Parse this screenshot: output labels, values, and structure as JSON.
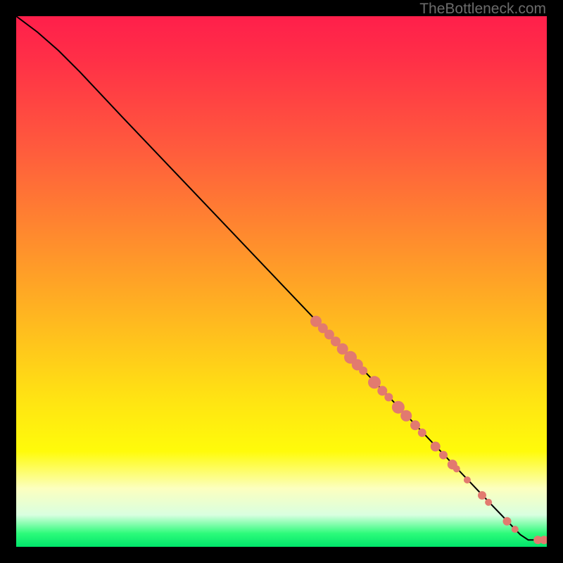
{
  "attribution": "TheBottleneck.com",
  "chart_data": {
    "type": "line",
    "title": "",
    "xlabel": "",
    "ylabel": "",
    "xlim": [
      0,
      100
    ],
    "ylim": [
      0,
      100
    ],
    "curve": {
      "name": "bottleneck-curve",
      "points": [
        {
          "x": 0,
          "y": 100
        },
        {
          "x": 4,
          "y": 97
        },
        {
          "x": 8,
          "y": 93.5
        },
        {
          "x": 12,
          "y": 89.5
        },
        {
          "x": 20,
          "y": 81
        },
        {
          "x": 30,
          "y": 70.5
        },
        {
          "x": 40,
          "y": 60
        },
        {
          "x": 50,
          "y": 49.5
        },
        {
          "x": 60,
          "y": 39
        },
        {
          "x": 70,
          "y": 28.5
        },
        {
          "x": 80,
          "y": 18
        },
        {
          "x": 90,
          "y": 7.5
        },
        {
          "x": 95,
          "y": 2.3
        },
        {
          "x": 96.5,
          "y": 1.3
        },
        {
          "x": 100,
          "y": 1.3
        }
      ]
    },
    "markers": {
      "name": "highlighted-points",
      "color": "#e27a6f",
      "points": [
        {
          "x": 56.5,
          "y": 42.5,
          "r": 8
        },
        {
          "x": 57.8,
          "y": 41.2,
          "r": 7
        },
        {
          "x": 59.0,
          "y": 40.0,
          "r": 7
        },
        {
          "x": 60.2,
          "y": 38.7,
          "r": 7
        },
        {
          "x": 61.5,
          "y": 37.3,
          "r": 8
        },
        {
          "x": 63.0,
          "y": 35.7,
          "r": 9
        },
        {
          "x": 64.3,
          "y": 34.3,
          "r": 8
        },
        {
          "x": 65.4,
          "y": 33.2,
          "r": 6
        },
        {
          "x": 67.5,
          "y": 31.0,
          "r": 9
        },
        {
          "x": 69.0,
          "y": 29.4,
          "r": 7
        },
        {
          "x": 70.2,
          "y": 28.2,
          "r": 6
        },
        {
          "x": 72.0,
          "y": 26.3,
          "r": 9
        },
        {
          "x": 73.5,
          "y": 24.7,
          "r": 8
        },
        {
          "x": 75.2,
          "y": 22.9,
          "r": 7
        },
        {
          "x": 76.5,
          "y": 21.5,
          "r": 6
        },
        {
          "x": 79.0,
          "y": 18.9,
          "r": 7
        },
        {
          "x": 80.5,
          "y": 17.3,
          "r": 6
        },
        {
          "x": 82.2,
          "y": 15.5,
          "r": 7
        },
        {
          "x": 83.0,
          "y": 14.7,
          "r": 5
        },
        {
          "x": 85.0,
          "y": 12.6,
          "r": 5
        },
        {
          "x": 87.8,
          "y": 9.7,
          "r": 6
        },
        {
          "x": 89.0,
          "y": 8.4,
          "r": 5
        },
        {
          "x": 92.5,
          "y": 4.8,
          "r": 6
        },
        {
          "x": 94.0,
          "y": 3.3,
          "r": 5
        },
        {
          "x": 98.3,
          "y": 1.3,
          "r": 6
        },
        {
          "x": 99.5,
          "y": 1.3,
          "r": 6
        }
      ]
    }
  }
}
